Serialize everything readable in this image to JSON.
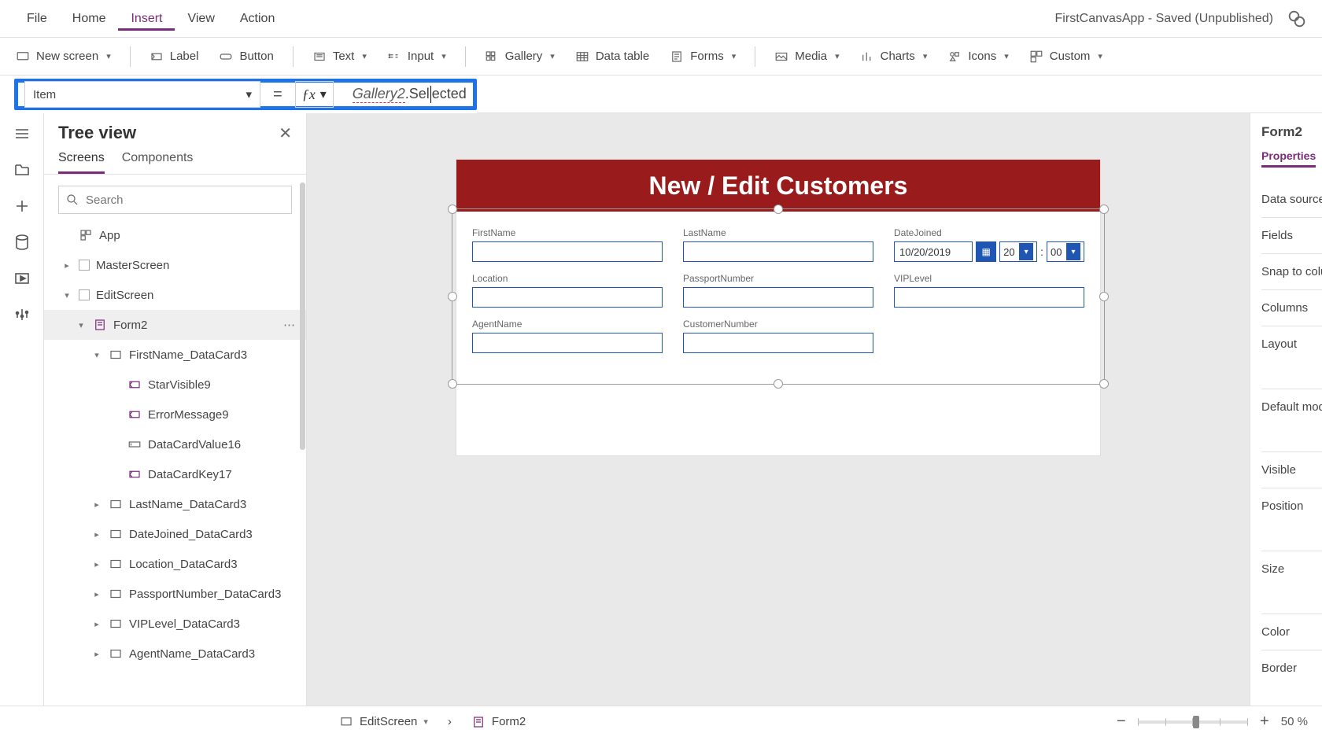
{
  "app": {
    "status": "FirstCanvasApp - Saved (Unpublished)"
  },
  "menu": {
    "file": "File",
    "home": "Home",
    "insert": "Insert",
    "view": "View",
    "action": "Action"
  },
  "ribbon": {
    "newscreen": "New screen",
    "label": "Label",
    "button": "Button",
    "text": "Text",
    "input": "Input",
    "gallery": "Gallery",
    "datatable": "Data table",
    "forms": "Forms",
    "media": "Media",
    "charts": "Charts",
    "icons": "Icons",
    "custom": "Custom"
  },
  "fx": {
    "property": "Item",
    "eq": "=",
    "tok_gallery": "Gallery2",
    "tok_member": ".Selected",
    "tooltip": "Selected"
  },
  "tree": {
    "title": "Tree view",
    "tab_screens": "Screens",
    "tab_components": "Components",
    "search_placeholder": "Search",
    "nodes": {
      "app": "App",
      "master": "MasterScreen",
      "edit": "EditScreen",
      "form2": "Form2",
      "fn": "FirstName_DataCard3",
      "star": "StarVisible9",
      "err": "ErrorMessage9",
      "dcv": "DataCardValue16",
      "dck": "DataCardKey17",
      "ln": "LastName_DataCard3",
      "dj": "DateJoined_DataCard3",
      "loc": "Location_DataCard3",
      "pn": "PassportNumber_DataCard3",
      "vip": "VIPLevel_DataCard3",
      "ag": "AgentName_DataCard3"
    }
  },
  "form": {
    "title": "New / Edit Customers",
    "labels": {
      "first": "FirstName",
      "last": "LastName",
      "date": "DateJoined",
      "loc": "Location",
      "pass": "PassportNumber",
      "vip": "VIPLevel",
      "agent": "AgentName",
      "cust": "CustomerNumber"
    },
    "date_value": "10/20/2019",
    "hour": "20",
    "minute": "00"
  },
  "props": {
    "selected": "Form2",
    "tab": "Properties",
    "rows": {
      "datasource": "Data source",
      "fields": "Fields",
      "snap": "Snap to columns",
      "columns": "Columns",
      "layout": "Layout",
      "defaultmode": "Default mode",
      "visible": "Visible",
      "position": "Position",
      "size": "Size",
      "color": "Color",
      "border": "Border"
    }
  },
  "crumb": {
    "screen": "EditScreen",
    "control": "Form2"
  },
  "zoom": {
    "value": "50",
    "unit": "%"
  }
}
